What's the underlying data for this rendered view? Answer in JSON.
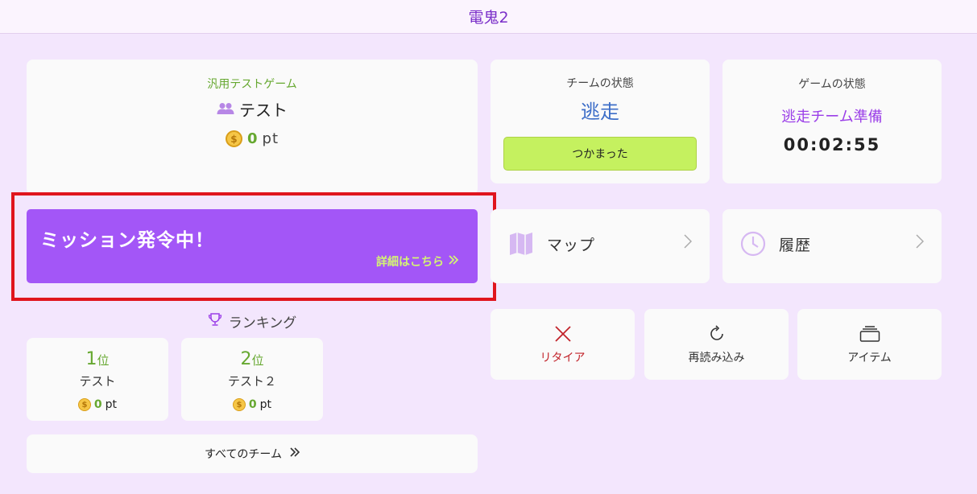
{
  "header": {
    "title": "電鬼2"
  },
  "team": {
    "game_name": "汎用テストゲーム",
    "name": "テスト",
    "points": "0",
    "points_unit": "pt"
  },
  "mission": {
    "title": "ミッション発令中！",
    "detail_link": "詳細はこちら"
  },
  "ranking": {
    "header": "ランキング",
    "entries": [
      {
        "rank": "1",
        "rank_suffix": "位",
        "name": "テスト",
        "points": "0",
        "unit": "pt"
      },
      {
        "rank": "2",
        "rank_suffix": "位",
        "name": "テスト２",
        "points": "0",
        "unit": "pt"
      }
    ],
    "all_teams_label": "すべてのチーム"
  },
  "team_status": {
    "label": "チームの状態",
    "value": "逃走",
    "caught_button": "つかまった"
  },
  "game_status": {
    "label": "ゲームの状態",
    "phase": "逃走チーム準備",
    "timer": "00:02:55"
  },
  "nav": {
    "map_label": "マップ",
    "history_label": "履歴"
  },
  "actions": {
    "retire_label": "リタイア",
    "reload_label": "再読み込み",
    "items_label": "アイテム"
  },
  "colors": {
    "background": "#f3e6fd",
    "accent_purple": "#a356f7",
    "accent_green": "#66a830",
    "caught_button": "#c5f15f",
    "highlight_red": "#e0151d"
  }
}
